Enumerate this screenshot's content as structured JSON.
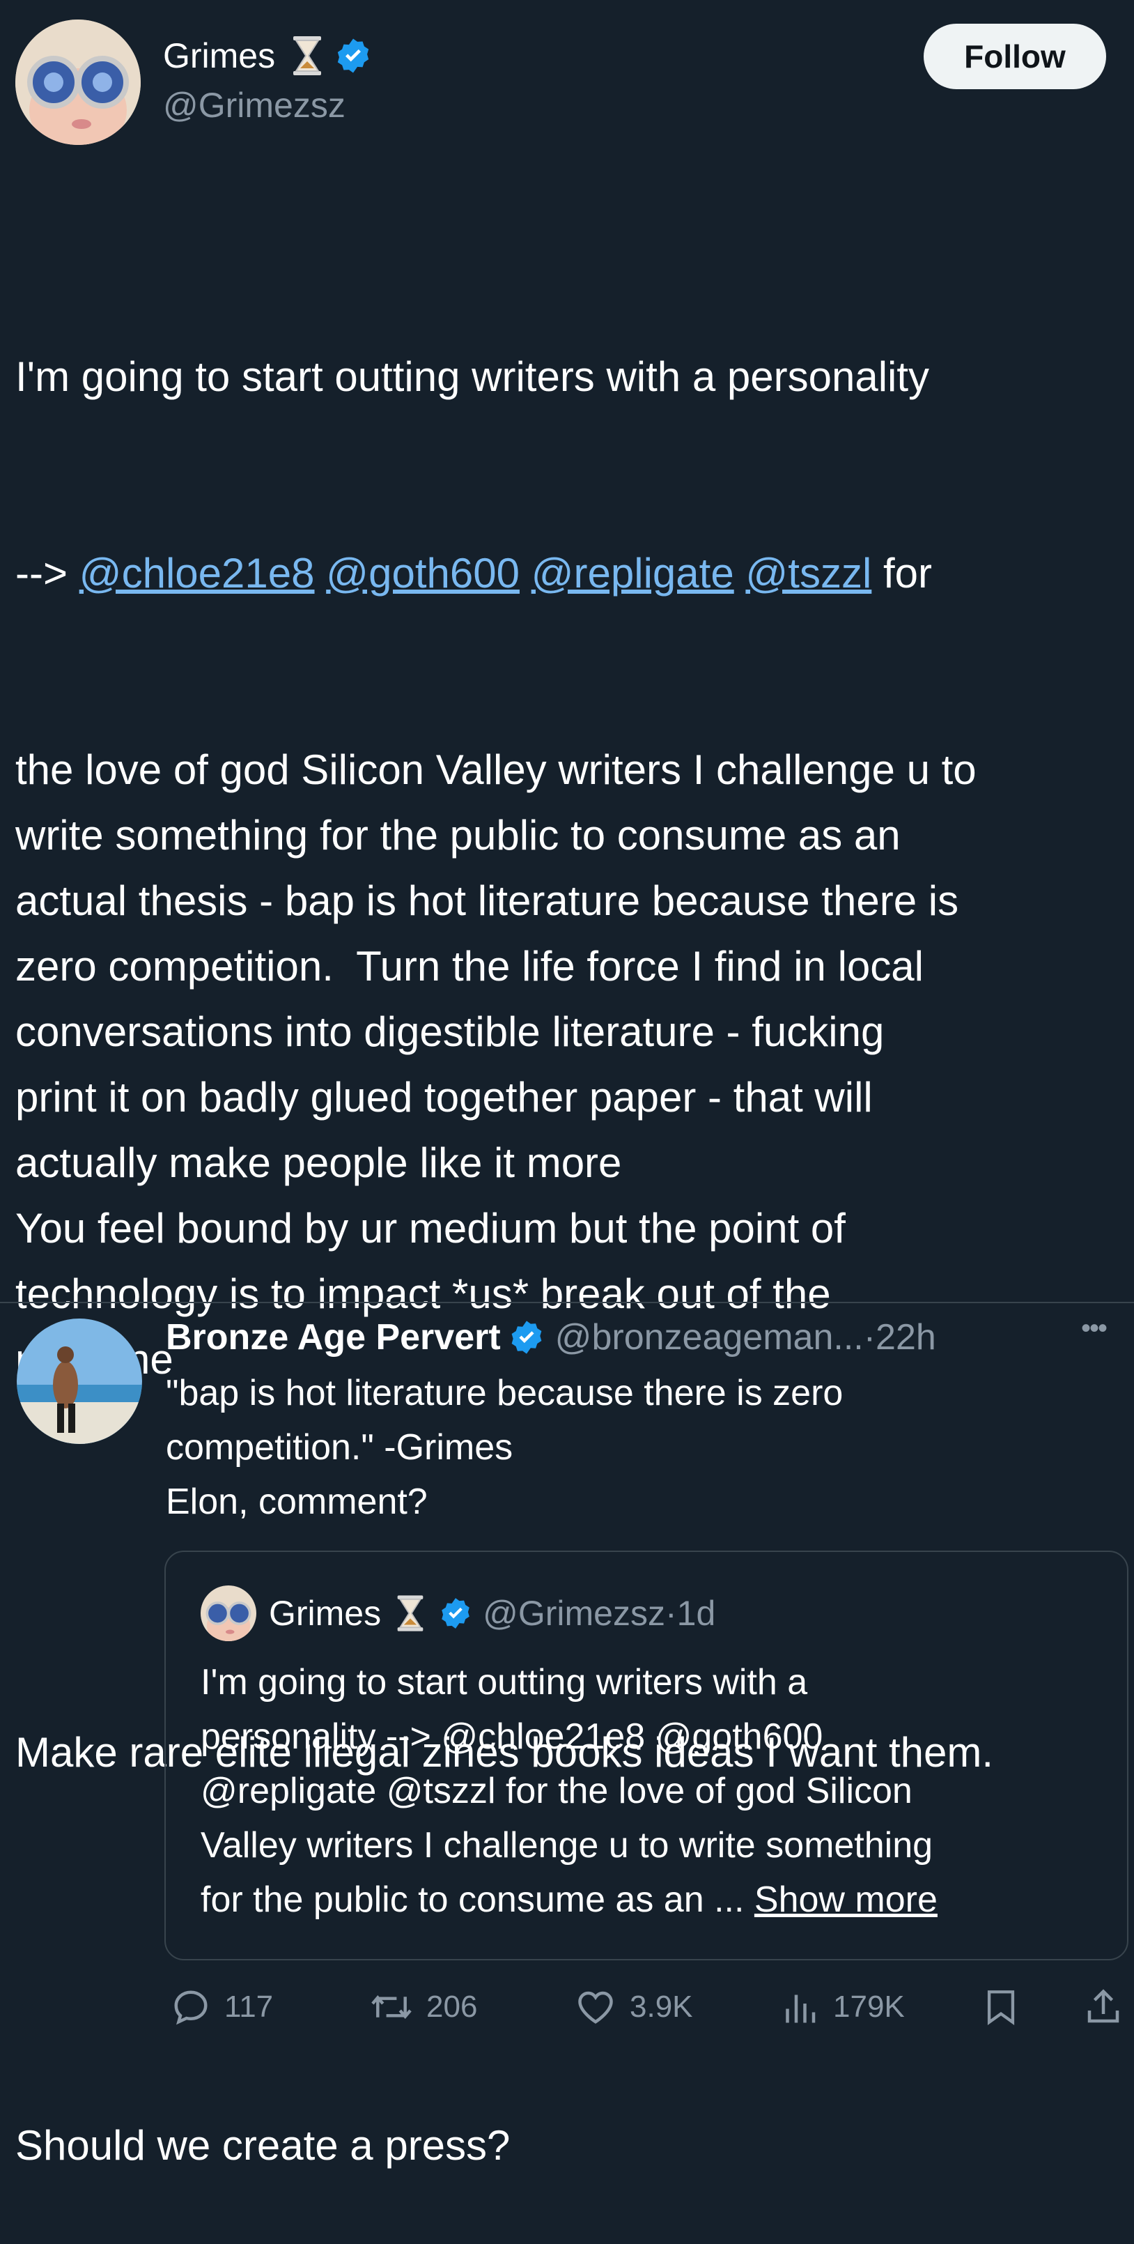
{
  "tweet": {
    "author_name": "Grimes",
    "author_handle": "@Grimezsz",
    "follow_label": "Follow",
    "text_line1": "I'm going to start outting writers with a personality",
    "text_arrow": "--> ",
    "mention1": "@chloe21e8",
    "mention2": "@goth600",
    "mention3": "@repligate",
    "mention4": "@tszzl",
    "text_after_mentions": " for",
    "text_rest": "the love of god Silicon Valley writers I challenge u to\nwrite something for the public to consume as an\nactual thesis - bap is hot literature because there is\nzero competition.  Turn the life force I find in local\nconversations into digestible literature - fucking\nprint it on badly glued together paper - that will\nactually make people like it more\nYou feel bound by ur medium but the point of\ntechnology is to impact *us* break out of the\nmachine",
    "text_para2": "Make rare elite illegal zines books ideas I want them.",
    "text_para3": "Should we create a press?"
  },
  "reply": {
    "author_name": "Bronze Age Pervert",
    "author_handle": "@bronzeageman...",
    "time": "·22h",
    "more_label": "•••",
    "text_line1": "\"bap is hot literature because there is zero",
    "text_line2": "competition.\" -Grimes",
    "text_line3": "Elon, comment?",
    "quote": {
      "author_name": "Grimes",
      "author_handle": "@Grimezsz",
      "time": "·1d",
      "line1": "I'm going to start outting writers with a",
      "line2": "personality --> @chloe21e8 @goth600",
      "line3": "@repligate @tszzl for the love of god Silicon",
      "line4": "Valley writers I challenge u to write something",
      "line5": "for the public to consume as an ... ",
      "show_more": "Show more"
    },
    "actions": {
      "replies": "117",
      "retweets": "206",
      "likes": "3.9K",
      "views": "179K"
    }
  },
  "colors": {
    "background": "#15202b",
    "link": "#79b8f0",
    "verified": "#1d9bf0",
    "muted": "#8b98a5"
  }
}
